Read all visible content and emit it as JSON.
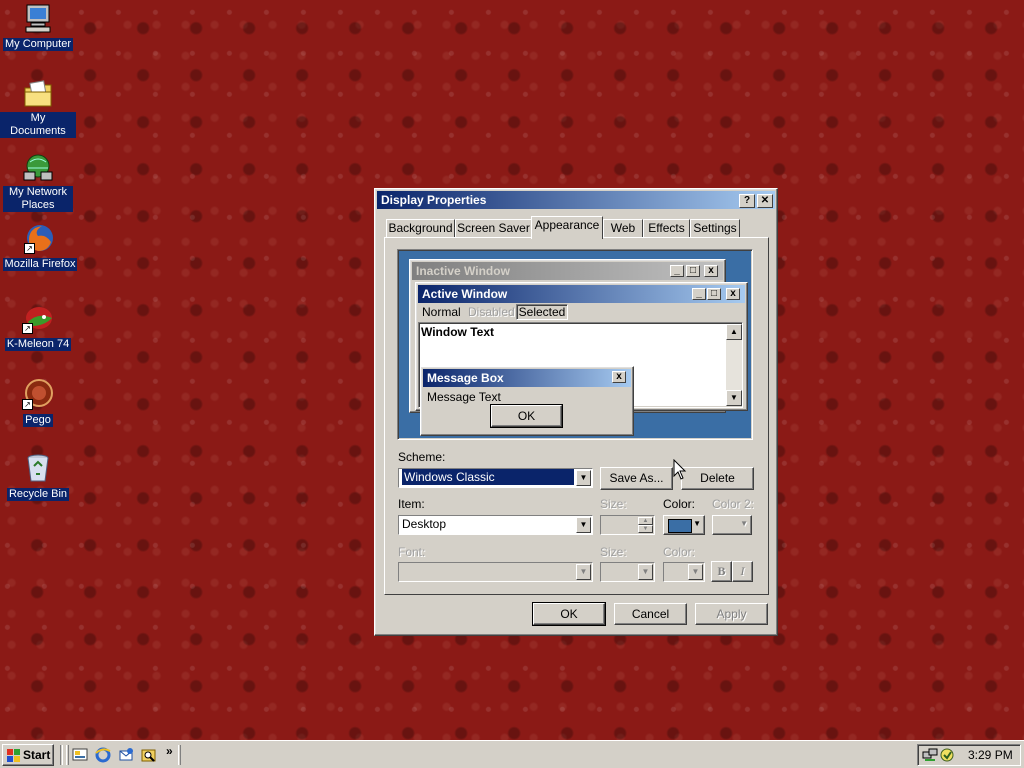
{
  "desktop": {
    "icons": [
      {
        "label": "My Computer",
        "icon": "computer-icon"
      },
      {
        "label": "My Documents",
        "icon": "folder-icon"
      },
      {
        "label": "My Network Places",
        "icon": "network-icon"
      },
      {
        "label": "Mozilla Firefox",
        "icon": "firefox-icon"
      },
      {
        "label": "K-Meleon 74",
        "icon": "kmeleon-icon"
      },
      {
        "label": "Pego",
        "icon": "pego-icon"
      },
      {
        "label": "Recycle Bin",
        "icon": "recycle-bin-icon"
      }
    ]
  },
  "dialog": {
    "title": "Display Properties",
    "help": "?",
    "close": "✕",
    "tabs": [
      "Background",
      "Screen Saver",
      "Appearance",
      "Web",
      "Effects",
      "Settings"
    ],
    "selected_tab": "Appearance",
    "preview": {
      "inactive_title": "Inactive Window",
      "active_title": "Active Window",
      "menu": [
        "Normal",
        "Disabled",
        "Selected"
      ],
      "window_text": "Window Text",
      "msgbox_title": "Message Box",
      "msgbox_text": "Message Text",
      "msgbox_ok": "OK"
    },
    "scheme": {
      "label": "Scheme:",
      "value": "Windows Classic",
      "save_as": "Save As...",
      "delete": "Delete"
    },
    "item": {
      "label": "Item:",
      "value": "Desktop",
      "size_label": "Size:",
      "color_label": "Color:",
      "color2_label": "Color 2:",
      "color_value": "#3a6ea5"
    },
    "font": {
      "label": "Font:",
      "size_label": "Size:",
      "color_label": "Color:",
      "bold": "B",
      "italic": "I"
    },
    "buttons": {
      "ok": "OK",
      "cancel": "Cancel",
      "apply": "Apply"
    }
  },
  "taskbar": {
    "start": "Start",
    "chevron": "»",
    "clock": "3:29 PM"
  },
  "colors": {
    "desktop_bg": "#8b1a16",
    "title_active": "#0a246a",
    "preview_bg": "#3a6ea5",
    "face": "#d4d0c8"
  }
}
